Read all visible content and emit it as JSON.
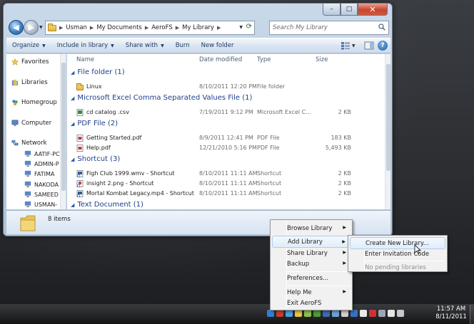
{
  "window": {
    "breadcrumb": [
      "Usman",
      "My Documents",
      "AeroFS",
      "My Library"
    ],
    "search_placeholder": "Search My Library",
    "controls": {
      "minimize": "–",
      "maximize": "□",
      "close": "✕"
    },
    "toolbar": {
      "organize": "Organize",
      "include_in_library": "Include in library",
      "share_with": "Share with",
      "burn": "Burn",
      "new_folder": "New folder",
      "help": "?"
    }
  },
  "nav_pane": {
    "favorites": "Favorites",
    "libraries": "Libraries",
    "homegroup": "Homegroup",
    "computer": "Computer",
    "network": "Network",
    "network_items": [
      "AATIF-PC",
      "ADMIN-P",
      "FATIMA",
      "NAKODA",
      "SAMEED",
      "USMAN-"
    ]
  },
  "columns": {
    "name": "Name",
    "date_modified": "Date modified",
    "type": "Type",
    "size": "Size"
  },
  "groups": [
    {
      "title": "File folder (1)",
      "files": [
        {
          "name": "Linux",
          "date": "8/10/2011 12:20 PM",
          "type": "File folder",
          "size": "",
          "icon": "folder-icon"
        }
      ]
    },
    {
      "title": "Microsoft Excel Comma Separated Values File (1)",
      "files": [
        {
          "name": "cd catalog .csv",
          "date": "7/19/2011 9:12 PM",
          "type": "Microsoft Excel C...",
          "size": "2 KB",
          "icon": "csv-file-icon"
        }
      ]
    },
    {
      "title": "PDF File (2)",
      "files": [
        {
          "name": "Getting Started.pdf",
          "date": "8/9/2011 12:41 PM",
          "type": "PDF File",
          "size": "183 KB",
          "icon": "pdf-file-icon"
        },
        {
          "name": "Help.pdf",
          "date": "12/21/2010 5:16 PM",
          "type": "PDF File",
          "size": "5,493 KB",
          "icon": "pdf-file-icon"
        }
      ]
    },
    {
      "title": "Shortcut (3)",
      "files": [
        {
          "name": "Figh Club 1999.wmv - Shortcut",
          "date": "8/10/2011 11:11 AM",
          "type": "Shortcut",
          "size": "2 KB",
          "icon": "video-shortcut-icon"
        },
        {
          "name": "insight 2.png - Shortcut",
          "date": "8/10/2011 11:11 AM",
          "type": "Shortcut",
          "size": "2 KB",
          "icon": "image-shortcut-icon"
        },
        {
          "name": "Mortal Kombat Legacy.mp4 - Shortcut",
          "date": "8/10/2011 11:11 AM",
          "type": "Shortcut",
          "size": "2 KB",
          "icon": "video-shortcut-icon"
        }
      ]
    },
    {
      "title": "Text Document (1)",
      "files": []
    }
  ],
  "details": {
    "count": "8 items"
  },
  "tray_menu": {
    "browse_library": "Browse Library",
    "add_library": "Add Library",
    "share_library": "Share Library",
    "backup": "Backup",
    "preferences": "Preferences...",
    "help_me": "Help Me",
    "exit": "Exit AeroFS"
  },
  "sub_menu": {
    "create_new_library": "Create New Library...",
    "enter_invitation_code": "Enter Invitation Code",
    "no_pending": "No pending libraries"
  },
  "clock": {
    "time": "11:57 AM",
    "date": "8/11/2011"
  },
  "colors": {
    "accent": "#1e3f8c",
    "highlight": "#e1ecf9",
    "window_frame": "#bccfe3"
  }
}
